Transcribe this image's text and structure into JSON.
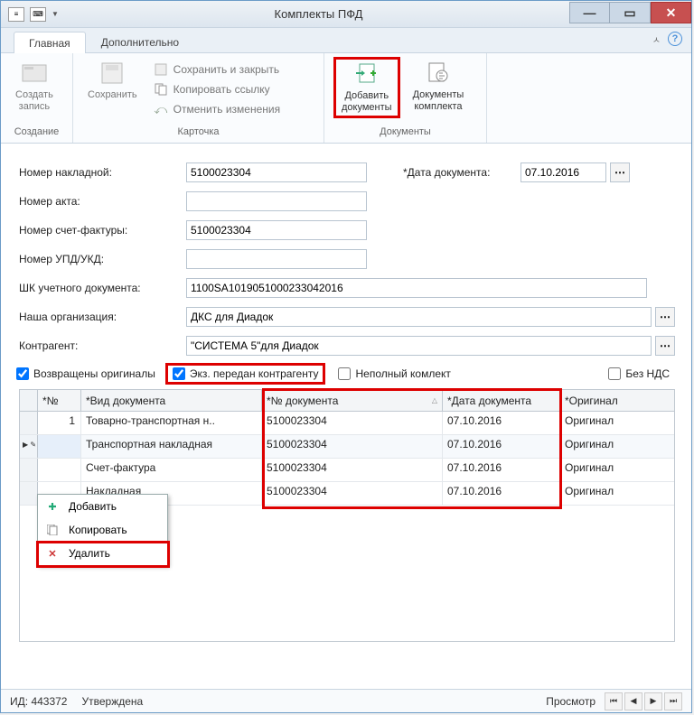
{
  "window": {
    "title": "Комплекты ПФД"
  },
  "tabs": {
    "main": "Главная",
    "extra": "Дополнительно"
  },
  "ribbon": {
    "group_create": "Создание",
    "group_card": "Карточка",
    "group_docs": "Документы",
    "create_entry": "Создать\nзапись",
    "save": "Сохранить",
    "save_close": "Сохранить и закрыть",
    "copy_link": "Копировать ссылку",
    "undo": "Отменить изменения",
    "add_doc": "Добавить\nдокументы",
    "set_docs": "Документы\nкомплекта"
  },
  "form": {
    "labels": {
      "invoice_no": "Номер накладной:",
      "act_no": "Номер акта:",
      "sf_no": "Номер счет-фактуры:",
      "upd_no": "Номер УПД/УКД:",
      "barcode": "ШК учетного документа:",
      "our_org": "Наша организация:",
      "counterparty": "Контрагент:",
      "doc_date": "*Дата документа:"
    },
    "values": {
      "invoice_no": "5100023304",
      "act_no": "",
      "sf_no": "5100023304",
      "upd_no": "",
      "barcode": "1100SA1019051000233042016",
      "our_org": "ДКС для Диадок",
      "counterparty": "\"СИСТЕМА 5\"для Диадок",
      "doc_date": "07.10.2016"
    }
  },
  "checks": {
    "originals_returned": "Возвращены оригиналы",
    "sent_to_cp": "Экз. передан контрагенту",
    "incomplete": "Неполный комлект",
    "no_vat": "Без НДС"
  },
  "grid": {
    "headers": {
      "no": "*№",
      "type": "*Вид документа",
      "docno": "*№ документа",
      "date": "*Дата документа",
      "orig": "*Оригинал"
    },
    "rows": [
      {
        "no": "1",
        "type": "Товарно-транспортная н..",
        "docno": "5100023304",
        "date": "07.10.2016",
        "orig": "Оригинал"
      },
      {
        "no": "",
        "type": "Транспортная накладная",
        "docno": "5100023304",
        "date": "07.10.2016",
        "orig": "Оригинал"
      },
      {
        "no": "",
        "type": "Счет-фактура",
        "docno": "5100023304",
        "date": "07.10.2016",
        "orig": "Оригинал"
      },
      {
        "no": "",
        "type": "Накладная",
        "docno": "5100023304",
        "date": "07.10.2016",
        "orig": "Оригинал"
      }
    ]
  },
  "context_menu": {
    "add": "Добавить",
    "copy": "Копировать",
    "delete": "Удалить"
  },
  "status": {
    "id_label": "ИД:",
    "id_value": "443372",
    "state": "Утверждена",
    "mode": "Просмотр"
  }
}
